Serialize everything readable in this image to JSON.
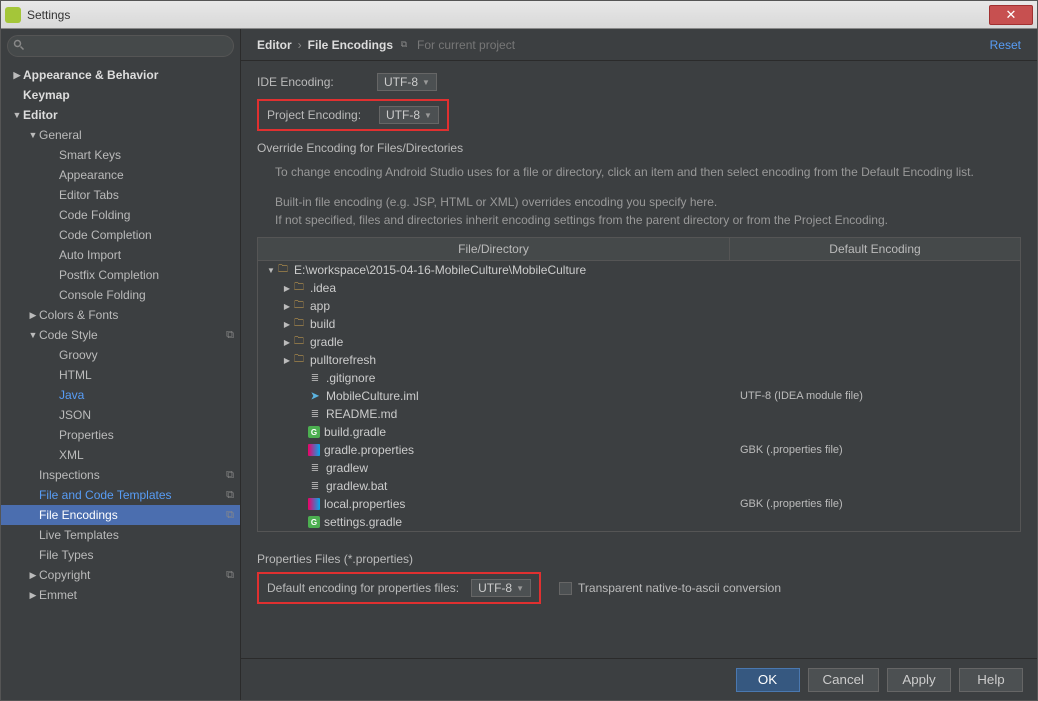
{
  "window": {
    "title": "Settings"
  },
  "search": {
    "placeholder": ""
  },
  "sidebar": [
    {
      "label": "Appearance & Behavior",
      "depth": 0,
      "arrow": "▶"
    },
    {
      "label": "Keymap",
      "depth": 0,
      "arrow": ""
    },
    {
      "label": "Editor",
      "depth": 0,
      "arrow": "▼"
    },
    {
      "label": "General",
      "depth": 1,
      "arrow": "▼"
    },
    {
      "label": "Smart Keys",
      "depth": 2,
      "arrow": ""
    },
    {
      "label": "Appearance",
      "depth": 2,
      "arrow": ""
    },
    {
      "label": "Editor Tabs",
      "depth": 2,
      "arrow": ""
    },
    {
      "label": "Code Folding",
      "depth": 2,
      "arrow": ""
    },
    {
      "label": "Code Completion",
      "depth": 2,
      "arrow": ""
    },
    {
      "label": "Auto Import",
      "depth": 2,
      "arrow": ""
    },
    {
      "label": "Postfix Completion",
      "depth": 2,
      "arrow": ""
    },
    {
      "label": "Console Folding",
      "depth": 2,
      "arrow": ""
    },
    {
      "label": "Colors & Fonts",
      "depth": 1,
      "arrow": "▶"
    },
    {
      "label": "Code Style",
      "depth": 1,
      "arrow": "▼",
      "badge": "⧉"
    },
    {
      "label": "Groovy",
      "depth": 2,
      "arrow": ""
    },
    {
      "label": "HTML",
      "depth": 2,
      "arrow": ""
    },
    {
      "label": "Java",
      "depth": 2,
      "arrow": "",
      "blue": true
    },
    {
      "label": "JSON",
      "depth": 2,
      "arrow": ""
    },
    {
      "label": "Properties",
      "depth": 2,
      "arrow": ""
    },
    {
      "label": "XML",
      "depth": 2,
      "arrow": ""
    },
    {
      "label": "Inspections",
      "depth": 1,
      "arrow": "",
      "badge": "⧉"
    },
    {
      "label": "File and Code Templates",
      "depth": 1,
      "arrow": "",
      "blue": true,
      "badge": "⧉"
    },
    {
      "label": "File Encodings",
      "depth": 1,
      "arrow": "",
      "sel": true,
      "badge": "⧉"
    },
    {
      "label": "Live Templates",
      "depth": 1,
      "arrow": ""
    },
    {
      "label": "File Types",
      "depth": 1,
      "arrow": ""
    },
    {
      "label": "Copyright",
      "depth": 1,
      "arrow": "▶",
      "badge": "⧉"
    },
    {
      "label": "Emmet",
      "depth": 1,
      "arrow": "▶"
    }
  ],
  "breadcrumb": {
    "parent": "Editor",
    "current": "File Encodings",
    "note": "For current project",
    "reset": "Reset"
  },
  "ideEncoding": {
    "label": "IDE Encoding:",
    "value": "UTF-8"
  },
  "projectEncoding": {
    "label": "Project Encoding:",
    "value": "UTF-8"
  },
  "overrideHeader": "Override Encoding for Files/Directories",
  "help1": "To change encoding Android Studio uses for a file or directory, click an item and then select encoding from the Default Encoding list.",
  "help2a": "Built-in file encoding (e.g. JSP, HTML or XML) overrides encoding you specify here.",
  "help2b": "If not specified, files and directories inherit encoding settings from the parent directory or from the Project Encoding.",
  "table": {
    "col1": "File/Directory",
    "col2": "Default Encoding",
    "rows": [
      {
        "indent": 0,
        "arrow": "▼",
        "icon": "folder",
        "name": "E:\\workspace\\2015-04-16-MobileCulture\\MobileCulture",
        "enc": ""
      },
      {
        "indent": 1,
        "arrow": "▶",
        "icon": "folder",
        "name": ".idea",
        "enc": ""
      },
      {
        "indent": 1,
        "arrow": "▶",
        "icon": "folder",
        "name": "app",
        "enc": ""
      },
      {
        "indent": 1,
        "arrow": "▶",
        "icon": "folder",
        "name": "build",
        "enc": ""
      },
      {
        "indent": 1,
        "arrow": "▶",
        "icon": "folder",
        "name": "gradle",
        "enc": ""
      },
      {
        "indent": 1,
        "arrow": "▶",
        "icon": "folder",
        "name": "pulltorefresh",
        "enc": ""
      },
      {
        "indent": 2,
        "arrow": "",
        "icon": "file",
        "name": ".gitignore",
        "enc": ""
      },
      {
        "indent": 2,
        "arrow": "",
        "icon": "iml",
        "name": "MobileCulture.iml",
        "enc": "UTF-8 (IDEA module file)"
      },
      {
        "indent": 2,
        "arrow": "",
        "icon": "file",
        "name": "README.md",
        "enc": ""
      },
      {
        "indent": 2,
        "arrow": "",
        "icon": "gradle",
        "name": "build.gradle",
        "enc": ""
      },
      {
        "indent": 2,
        "arrow": "",
        "icon": "prop",
        "name": "gradle.properties",
        "enc": "GBK (.properties file)"
      },
      {
        "indent": 2,
        "arrow": "",
        "icon": "file",
        "name": "gradlew",
        "enc": ""
      },
      {
        "indent": 2,
        "arrow": "",
        "icon": "file",
        "name": "gradlew.bat",
        "enc": ""
      },
      {
        "indent": 2,
        "arrow": "",
        "icon": "prop",
        "name": "local.properties",
        "enc": "GBK (.properties file)"
      },
      {
        "indent": 2,
        "arrow": "",
        "icon": "gradle",
        "name": "settings.gradle",
        "enc": ""
      }
    ]
  },
  "propsSection": {
    "title": "Properties Files (*.properties)",
    "label": "Default encoding for properties files:",
    "value": "UTF-8",
    "checkbox": "Transparent native-to-ascii conversion"
  },
  "buttons": {
    "ok": "OK",
    "cancel": "Cancel",
    "apply": "Apply",
    "help": "Help"
  }
}
